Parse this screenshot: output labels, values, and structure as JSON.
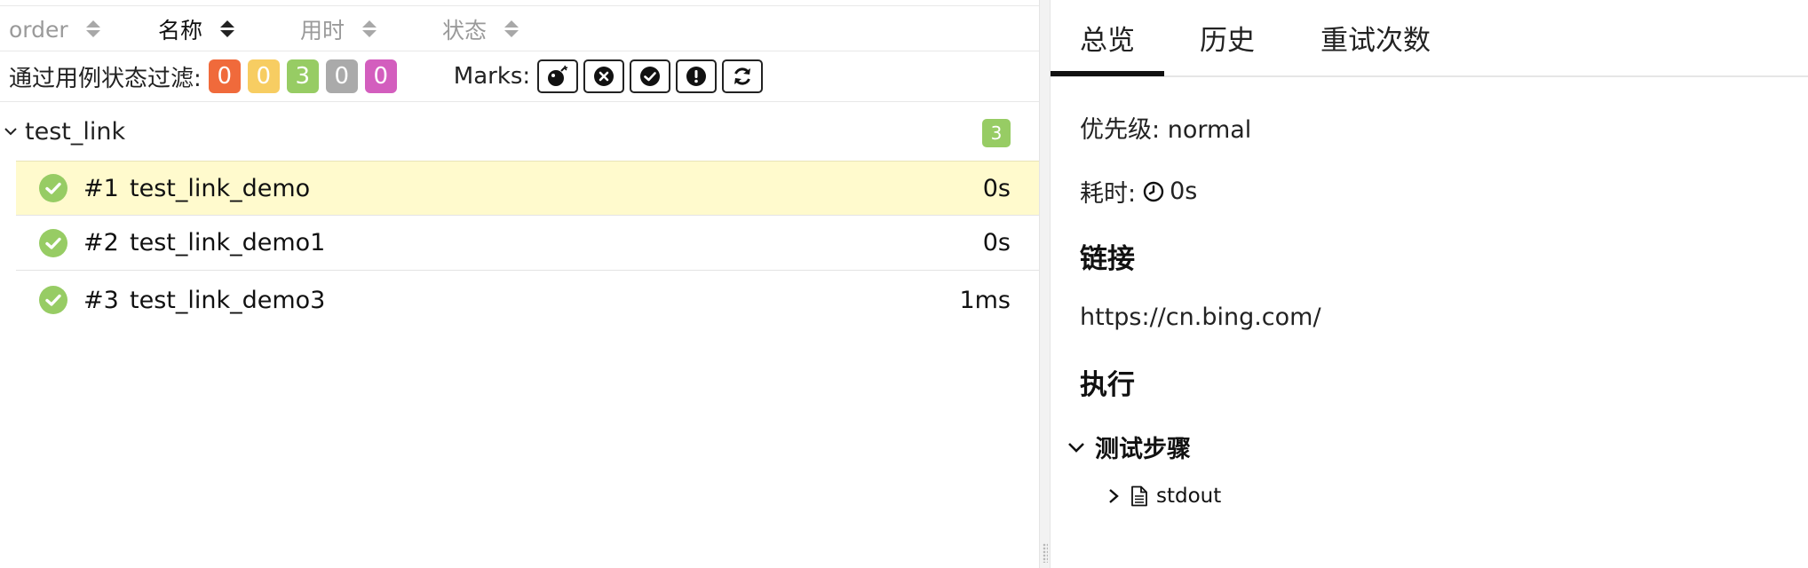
{
  "sort_header": {
    "columns": [
      {
        "label": "order",
        "active": false
      },
      {
        "label": "名称",
        "active": true
      },
      {
        "label": "用时",
        "active": false
      },
      {
        "label": "状态",
        "active": false
      }
    ]
  },
  "filter": {
    "label": "通过用例状态过滤:",
    "badges": [
      {
        "value": "0",
        "color": "#f06a3b"
      },
      {
        "value": "0",
        "color": "#f7cd62"
      },
      {
        "value": "3",
        "color": "#97cc64"
      },
      {
        "value": "0",
        "color": "#aaaaaa"
      },
      {
        "value": "0",
        "color": "#d35ebe"
      }
    ],
    "marks_label": "Marks:",
    "marks": [
      "bomb-icon",
      "close-circle-icon",
      "check-circle-icon",
      "exclamation-circle-icon",
      "refresh-icon"
    ]
  },
  "tree": {
    "group_name": "test_link",
    "group_count": "3",
    "rows": [
      {
        "num": "#1",
        "name": "test_link_demo",
        "duration": "0s",
        "status": "passed"
      },
      {
        "num": "#2",
        "name": "test_link_demo1",
        "duration": "0s",
        "status": "passed"
      },
      {
        "num": "#3",
        "name": "test_link_demo3",
        "duration": "1ms",
        "status": "passed"
      }
    ]
  },
  "details": {
    "tabs": [
      "总览",
      "历史",
      "重试次数"
    ],
    "active_tab": "总览",
    "priority_label": "优先级:",
    "priority_value": "normal",
    "duration_label": "耗时:",
    "duration_value": "0s",
    "links_heading": "链接",
    "link_url": "https://cn.bing.com/",
    "execution_heading": "执行",
    "steps_label": "测试步骤",
    "attachment_name": "stdout"
  },
  "colors": {
    "passed": "#97cc64",
    "selected_row": "#fffacd"
  }
}
